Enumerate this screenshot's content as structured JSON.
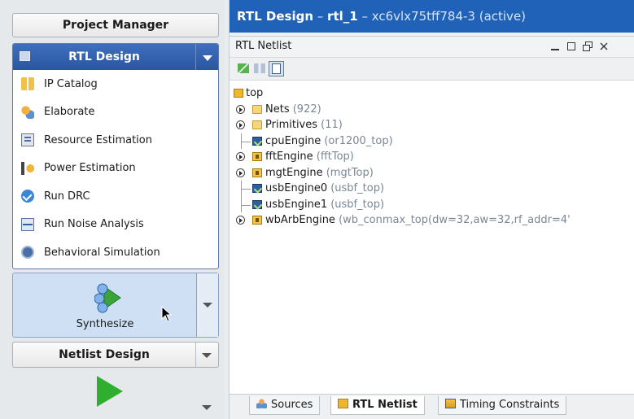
{
  "left": {
    "project_manager_label": "Project Manager",
    "rtl_panel_title": "RTL Design",
    "rtl_items": [
      {
        "label": "IP Catalog",
        "icon": "ip-catalog-icon"
      },
      {
        "label": "Elaborate",
        "icon": "elaborate-icon"
      },
      {
        "label": "Resource Estimation",
        "icon": "resource-estimation-icon"
      },
      {
        "label": "Power Estimation",
        "icon": "power-estimation-icon"
      },
      {
        "label": "Run DRC",
        "icon": "run-drc-icon"
      },
      {
        "label": "Run Noise Analysis",
        "icon": "noise-analysis-icon"
      },
      {
        "label": "Behavioral Simulation",
        "icon": "simulation-icon"
      }
    ],
    "synthesize_label": "Synthesize",
    "netlist_design_label": "Netlist Design"
  },
  "header": {
    "title_prefix": "RTL Design",
    "sep1": " – ",
    "design": "rtl_1",
    "rest": " – xc6vlx75tff784-3 (active)"
  },
  "window": {
    "title": "RTL Netlist",
    "controls": [
      "minimize",
      "maximize",
      "restore",
      "close"
    ]
  },
  "tree": {
    "root": "top",
    "items": [
      {
        "name": "Nets",
        "sub": " (922)",
        "type": "folder",
        "expandable": true
      },
      {
        "name": "Primitives",
        "sub": " (11)",
        "type": "folder",
        "expandable": true
      },
      {
        "name": "cpuEngine",
        "sub": " (or1200_top)",
        "type": "instance",
        "expandable": false
      },
      {
        "name": "fftEngine",
        "sub": " (fftTop)",
        "type": "module",
        "expandable": true
      },
      {
        "name": "mgtEngine",
        "sub": " (mgtTop)",
        "type": "module",
        "expandable": true
      },
      {
        "name": "usbEngine0",
        "sub": " (usbf_top)",
        "type": "instance",
        "expandable": false
      },
      {
        "name": "usbEngine1",
        "sub": " (usbf_top)",
        "type": "instance",
        "expandable": false
      },
      {
        "name": "wbArbEngine",
        "sub": " (wb_conmax_top(dw=32,aw=32,rf_addr=4'",
        "type": "module",
        "expandable": true
      }
    ]
  },
  "tabs": [
    {
      "label": "Sources",
      "icon": "sources-icon",
      "active": false
    },
    {
      "label": "RTL Netlist",
      "icon": "rtl-netlist-icon",
      "active": true
    },
    {
      "label": "Timing Constraints",
      "icon": "timing-constraints-icon",
      "active": false
    }
  ],
  "colors": {
    "header_blue": "#1f62b8",
    "panel_blue": "#2a56a0",
    "synth_bg": "#cfe0f5",
    "run_green": "#2fae2f"
  }
}
